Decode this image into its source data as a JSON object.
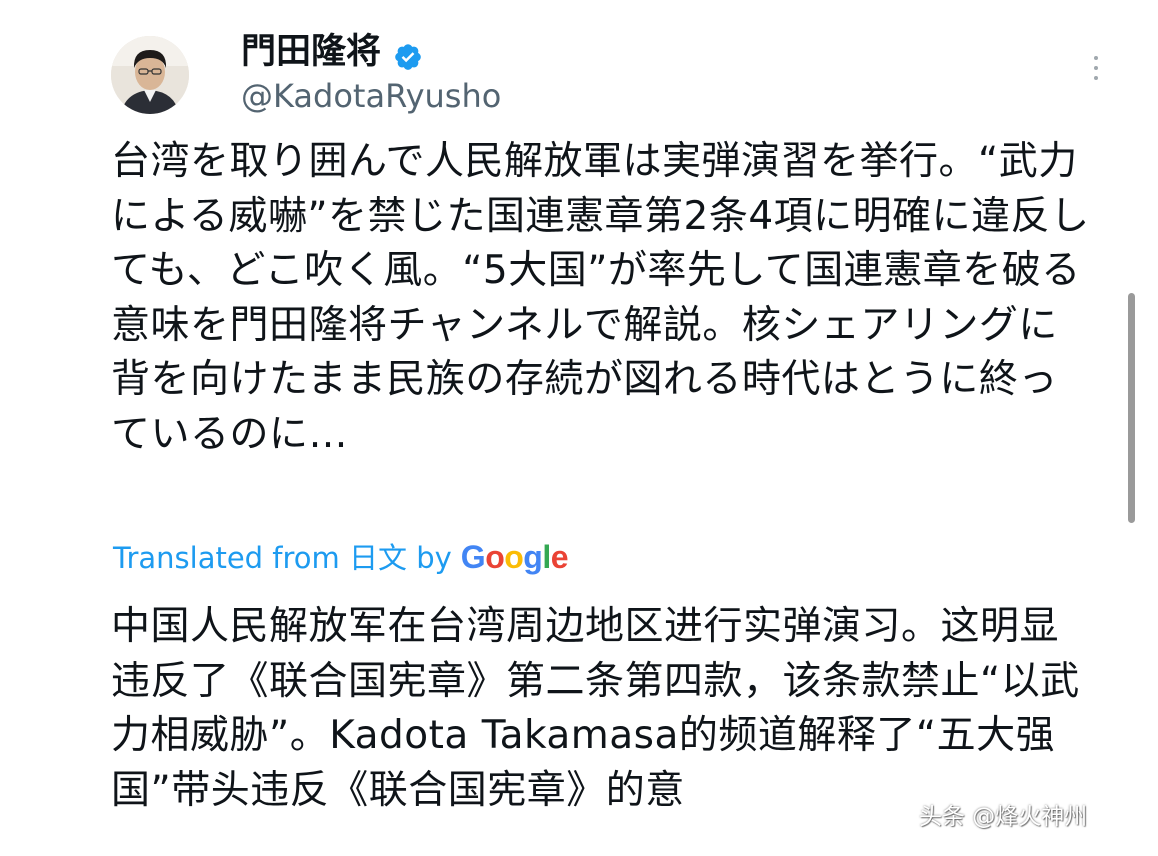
{
  "author": {
    "display_name": "門田隆将",
    "handle": "@KadotaRyusho",
    "verified": true,
    "avatar_icon": "profile-photo"
  },
  "tweet": {
    "text": "台湾を取り囲んで人民解放軍は実弾演習を挙行。“武力による威嚇”を禁じた国連憲章第2条4項に明確に違反しても、どこ吹く風。“5大国”が率先して国連憲章を破る意味を門田隆将チャンネルで解説。核シェアリングに背を向けたまま民族の存続が図れる時代はとうに終っているのに…"
  },
  "translation": {
    "label": "Translated from 日文 by",
    "provider": "Google",
    "text": "中国人民解放军在台湾周边地区进行实弹演习。这明显违反了《联合国宪章》第二条第四款，该条款禁止“以武力相威胁”。Kadota Takamasa的频道解释了“五大强国”带头违反《联合国宪章》的意"
  },
  "watermark": "头条 @烽火神州",
  "colors": {
    "link_blue": "#1d9bf0",
    "verified_blue": "#1d9bf0",
    "secondary_text": "#536471",
    "primary_text": "#0f1419"
  },
  "icons": [
    "verified-badge-icon",
    "more-options-icon"
  ]
}
